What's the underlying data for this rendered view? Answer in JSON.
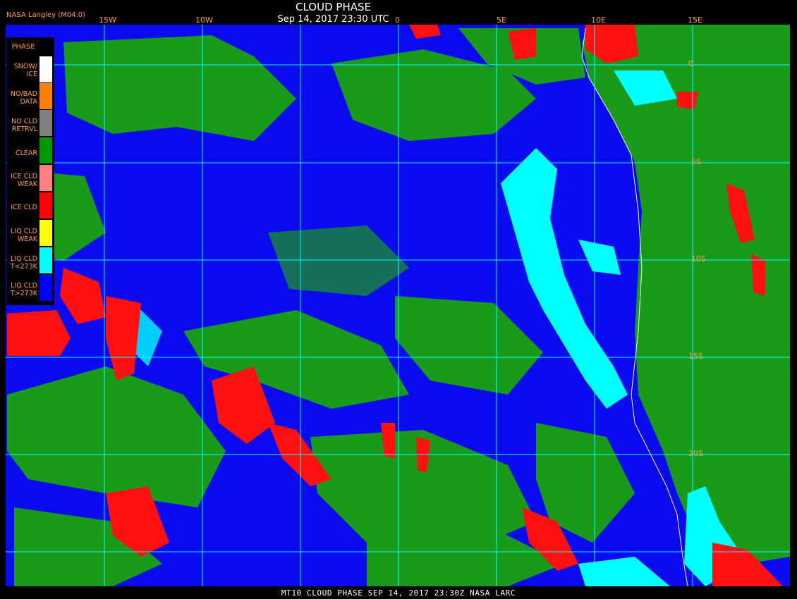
{
  "header": {
    "title": "CLOUD PHASE",
    "subtitle": "Sep 14, 2017 23:30 UTC",
    "org": "NASA Langley (M04.0)"
  },
  "footer": {
    "text": "MT10  CLOUD PHASE   SEP 14, 2017 23:30Z   NASA LARC"
  },
  "legend": {
    "title": "PHASE",
    "items": [
      {
        "label": "SNOW/\nICE",
        "color": "#ffffff"
      },
      {
        "label": "NO/BAD\nDATA",
        "color": "#ff8000"
      },
      {
        "label": "NO CLD\nRETRVL",
        "color": "#808080"
      },
      {
        "label": "CLEAR",
        "color": "#009900"
      },
      {
        "label": "ICE CLD\nWEAK",
        "color": "#ff8080"
      },
      {
        "label": "ICE CLD",
        "color": "#ff0000"
      },
      {
        "label": "LIQ CLD\nWEAK",
        "color": "#ffff00"
      },
      {
        "label": "LIQ CLD\nT<273K",
        "color": "#00ffff"
      },
      {
        "label": "LIQ CLD\nT>273K",
        "color": "#0000ff"
      }
    ]
  },
  "longitude_labels": [
    "15W",
    "10W",
    "5W",
    "0",
    "5E",
    "10E",
    "15E"
  ],
  "latitude_labels": [
    "0",
    "5S",
    "10S",
    "15S",
    "20S"
  ],
  "colors": {
    "ocean_liquid_cloud": "#0a0aee",
    "clear": "#1a9a1a",
    "ice_cloud": "#ff1010",
    "cold_liquid_cloud": "#00ffff",
    "grid": "#00ffff",
    "coastline": "#ffffff"
  }
}
